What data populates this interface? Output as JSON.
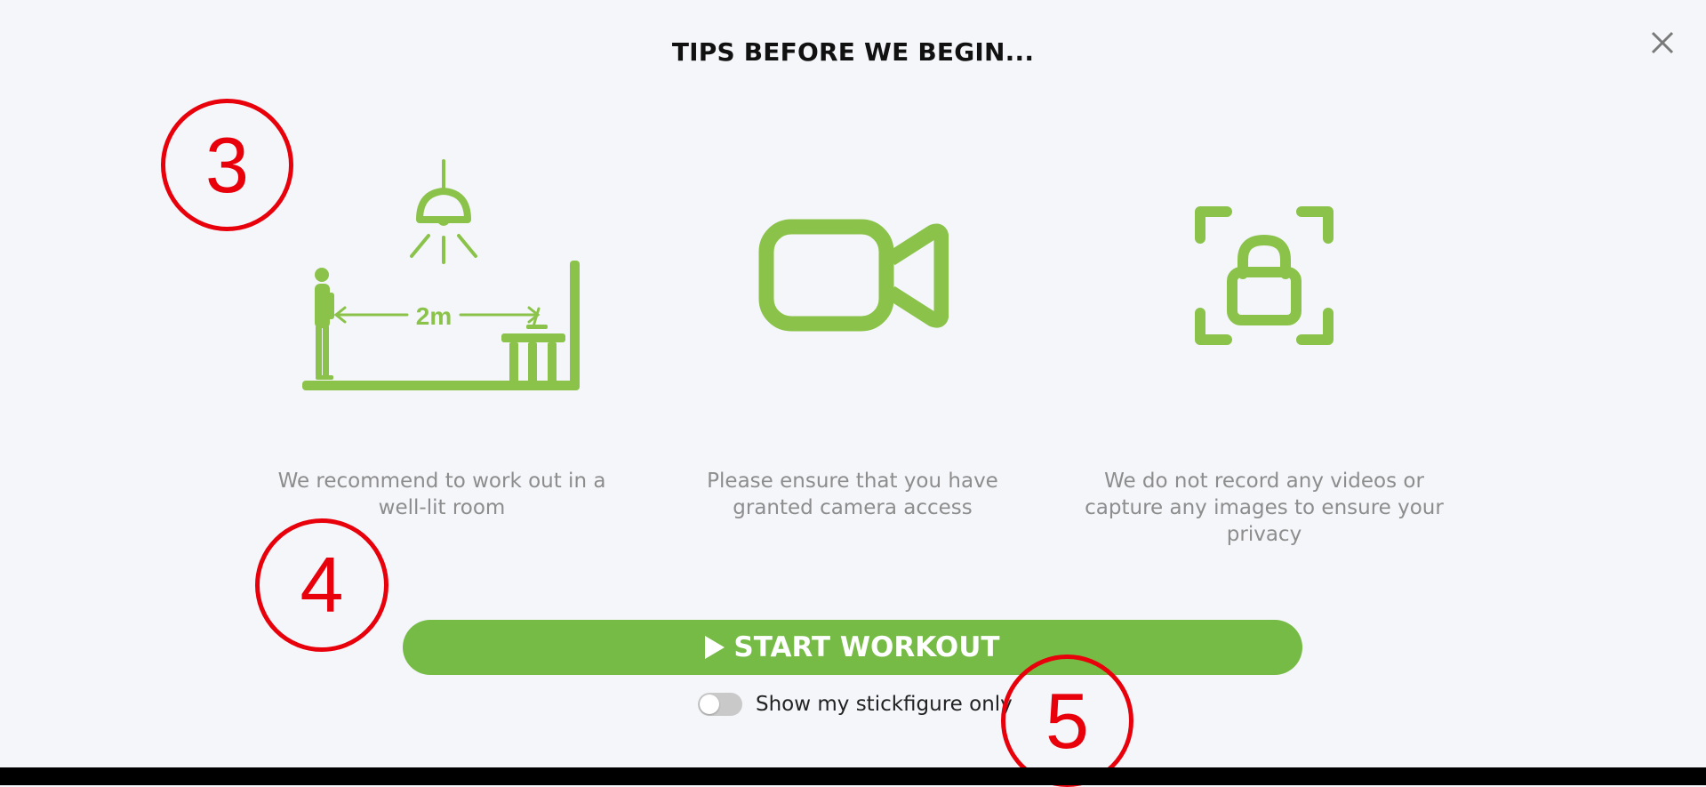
{
  "dialog": {
    "title": "TIPS BEFORE WE BEGIN...",
    "close_icon": "close-icon"
  },
  "tips": [
    {
      "icon": "lighting-distance-icon",
      "distance_label": "2m",
      "text": "We recommend to work out in a well-lit room"
    },
    {
      "icon": "video-camera-icon",
      "text": "Please ensure that you have granted camera access"
    },
    {
      "icon": "privacy-lock-icon",
      "text": "We do not record any videos or capture any images to ensure your privacy"
    }
  ],
  "start_button": {
    "label": "START WORKOUT",
    "icon": "play-icon"
  },
  "stickfigure_toggle": {
    "label": "Show my stickfigure only",
    "checked": false
  },
  "annotations": [
    "3",
    "4",
    "5"
  ],
  "colors": {
    "accent": "#76bb45",
    "icon_green": "#8bc34a",
    "annotation_red": "#e8000b",
    "text_gray": "#8d8d8d"
  }
}
